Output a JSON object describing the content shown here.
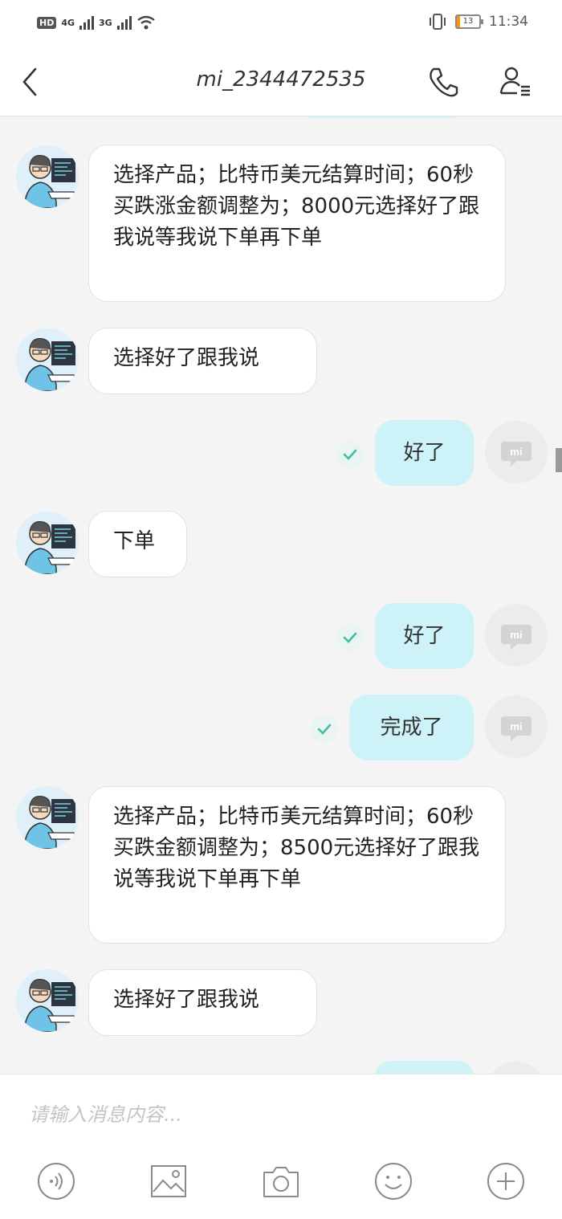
{
  "status": {
    "network_badges": [
      "HD",
      "4G",
      "3G"
    ],
    "battery_level": "13",
    "time": "11:34"
  },
  "header": {
    "title": "mi_2344472535",
    "icons": [
      "back-icon",
      "phone-icon",
      "contact-list-icon"
    ]
  },
  "messages": [
    {
      "dir": "in",
      "text": "选择产品；比特币美元结算时间；60秒买跌涨金额调整为；8000元选择好了跟我说等我说下单再下单"
    },
    {
      "dir": "in",
      "text": "选择好了跟我说"
    },
    {
      "dir": "out",
      "text": "好了"
    },
    {
      "dir": "in",
      "text": "下单"
    },
    {
      "dir": "out",
      "text": "好了"
    },
    {
      "dir": "out",
      "text": "完成了"
    },
    {
      "dir": "in",
      "text": "选择产品；比特币美元结算时间；60秒买跌金额调整为；8500元选择好了跟我说等我说下单再下单"
    },
    {
      "dir": "in",
      "text": "选择好了跟我说"
    }
  ],
  "input": {
    "placeholder": "请输入消息内容..."
  },
  "toolbar": {
    "icons": [
      "voice-icon",
      "image-icon",
      "camera-icon",
      "emoji-icon",
      "add-icon"
    ]
  },
  "colors": {
    "outgoing_bubble": "#cdf3f8",
    "check": "#3fbf9f",
    "battery_fill": "#ff9800"
  }
}
